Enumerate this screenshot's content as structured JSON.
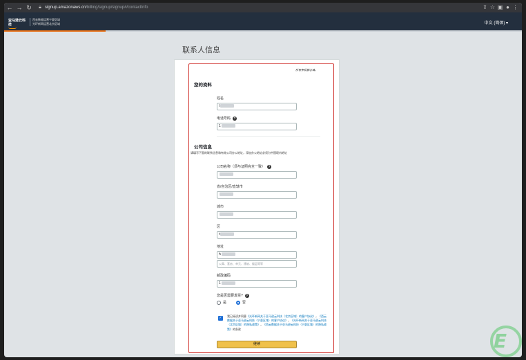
{
  "browser": {
    "url_host": "signup.amazonaws.cn",
    "url_path": "/billing/signup/signup#/contactInfo"
  },
  "header": {
    "logo_text": "亚马逊云科技",
    "logo_sub": "西云数据运营宁夏区域\n光环新网运营北京区域",
    "language": "中文 (简体) ▾"
  },
  "page": {
    "title": "联系人信息",
    "required_note": "所有字段都必填。"
  },
  "your_info": {
    "heading": "您的资料",
    "name_label": "姓名",
    "name_value": "l",
    "phone_label": "电话号码",
    "phone_value": "1"
  },
  "company_info": {
    "heading": "公司信息",
    "description": "请填写下面的联系信息和有效公司办公地址，添加办公地址必须为中国境内地址",
    "company_name_label": "公司名称（须与证照完全一致）",
    "company_name_value": "",
    "province_label": "省/自治区/直辖市",
    "province_value": "",
    "city_label": "城市",
    "city_value": "",
    "district_label": "区",
    "district_value": "t",
    "address_label": "地址",
    "address_value": "h",
    "address2_placeholder": "公寓、套房、单元、建筑、楼层等等",
    "postal_label": "邮政编码",
    "postal_value": "1"
  },
  "marketplace": {
    "question": "您是否需要发票?",
    "option_yes": "是",
    "option_no": "否",
    "selected": "否"
  },
  "agreement": {
    "prefix": "我已阅读并同意",
    "link1": "《光环新网关于亚马逊云科技（北京区域）的客户协议》",
    "sep1": "，",
    "link2": "《西云数据关于亚马逊云科技（宁夏区域）的客户协议》",
    "sep2": "，",
    "link3": "《光环新网关于亚马逊云科技（北京区域）的隐私政策》",
    "sep3": "，",
    "link4": "《西云数据关于亚马逊云科技（宁夏区域）的隐私政策》",
    "suffix": "的条款"
  },
  "actions": {
    "continue_label": "继续"
  },
  "colors": {
    "header_bg": "#232f3e",
    "progress": "#e8731a",
    "highlight_border": "#d0312d",
    "button": "#f0c14b"
  }
}
